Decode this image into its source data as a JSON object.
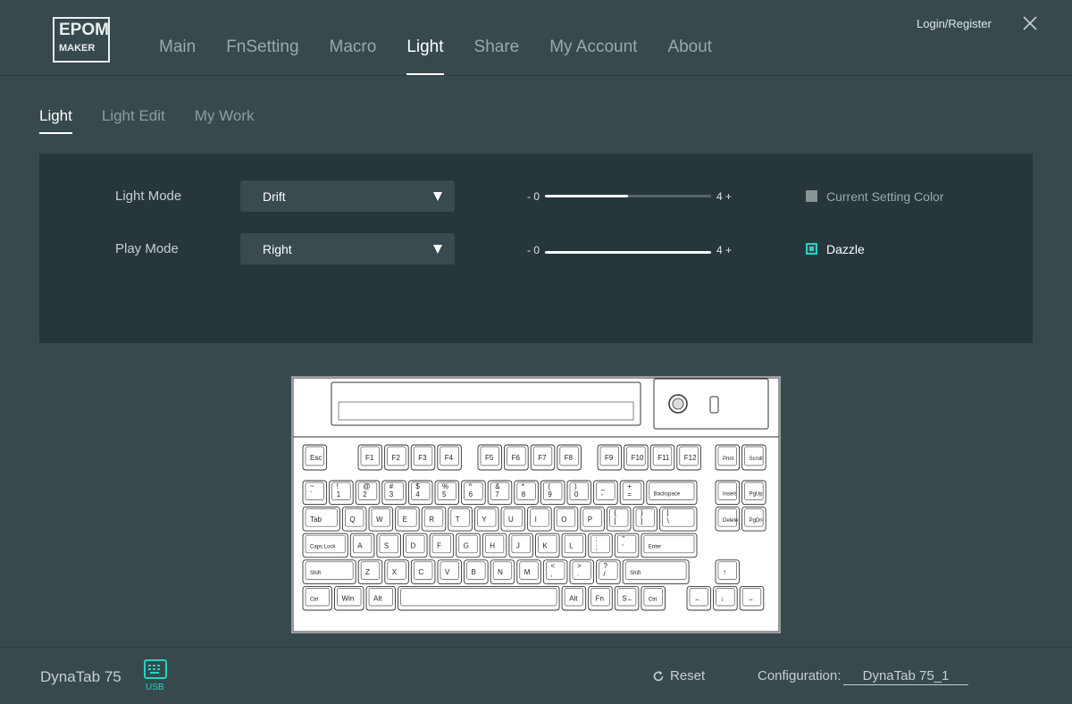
{
  "header": {
    "logo": {
      "line1": "EPOM",
      "line2": "MAKER"
    },
    "nav": [
      "Main",
      "FnSetting",
      "Macro",
      "Light",
      "Share",
      "My Account",
      "About"
    ],
    "nav_active": 3,
    "login": "Login/Register"
  },
  "subtabs": [
    "Light",
    "Light Edit",
    "My Work"
  ],
  "subtabs_active": 0,
  "panel": {
    "light_mode_label": "Light Mode",
    "light_mode_value": "Drift",
    "play_mode_label": "Play Mode",
    "play_mode_value": "Right",
    "brightness": {
      "min_label": "- 0",
      "max_label": "4 +",
      "fraction": 0.5
    },
    "speed": {
      "min_label": "- 0",
      "max_label": "4 +",
      "fraction": 1.0
    },
    "current_color_label": "Current Setting Color",
    "current_color_checked": false,
    "dazzle_label": "Dazzle",
    "dazzle_checked": true
  },
  "keyboard": {
    "rows": [
      [
        "Esc",
        "F1",
        "F2",
        "F3",
        "F4",
        "F5",
        "F6",
        "F7",
        "F8",
        "F9",
        "F10",
        "F11",
        "F12",
        "Print",
        "Scroll"
      ],
      [
        "~\n`",
        "!\n1",
        "@\n2",
        "#\n3",
        "$\n4",
        "%\n5",
        "^\n6",
        "&\n7",
        "*\n8",
        "(\n9",
        ")\n0",
        "_\n-",
        "+\n=",
        "Backspace",
        "Insert",
        "PgUp"
      ],
      [
        "Tab",
        "Q",
        "W",
        "E",
        "R",
        "T",
        "Y",
        "U",
        "I",
        "O",
        "P",
        "{\n[",
        "}\n]",
        "|\n\\",
        "Delete",
        "PgDn"
      ],
      [
        "Caps Lock",
        "A",
        "S",
        "D",
        "F",
        "G",
        "H",
        "J",
        "K",
        "L",
        ":\n;",
        "\"\n'",
        "Enter"
      ],
      [
        "Shift",
        "Z",
        "X",
        "C",
        "V",
        "B",
        "N",
        "M",
        "<\n,",
        ">\n.",
        "?\n/",
        "Shift",
        "↑"
      ],
      [
        "Ctrl",
        "Win",
        "Alt",
        "",
        "Alt",
        "Fn",
        "S←",
        "Ctrl",
        "←",
        "↓",
        "→"
      ]
    ]
  },
  "footer": {
    "device": "DynaTab 75",
    "usb": "USB",
    "reset": "Reset",
    "config_label": "Configuration:",
    "config_value": "DynaTab 75_1"
  },
  "colors": {
    "accent": "#22d3c5",
    "panel": "#26363a",
    "background": "#37494c"
  }
}
